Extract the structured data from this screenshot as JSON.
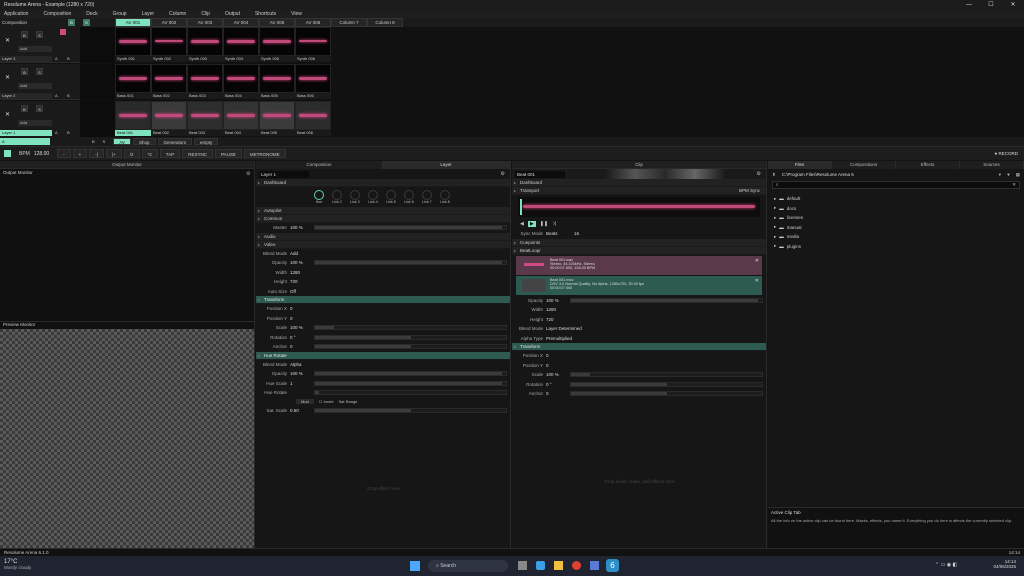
{
  "window": {
    "title": "Resolume Arena - Example (1280 x 720)",
    "controls": [
      "—",
      "☐",
      "✕"
    ]
  },
  "menu": [
    "Application",
    "Composition",
    "Deck",
    "Group",
    "Layer",
    "Column",
    "Clip",
    "Output",
    "Shortcuts",
    "View"
  ],
  "composition_label": "Composition",
  "columns": [
    "AV 001",
    "AV 002",
    "AV 003",
    "AV 004",
    "AV 005",
    "AV 006",
    "Column 7",
    "Column 8"
  ],
  "layers": [
    {
      "name": "Layer 3",
      "blend": "Add",
      "clips": [
        "Synth 001",
        "Synth 002",
        "Synth 003",
        "Synth 004",
        "Synth 005",
        "Synth 006"
      ]
    },
    {
      "name": "Layer 2",
      "blend": "Add",
      "clips": [
        "Bass 001",
        "Bass 002",
        "Bass 003",
        "Bass 004",
        "Bass 005",
        "Bass 006"
      ]
    },
    {
      "name": "Layer 1",
      "blend": "Add",
      "clips": [
        "Beat 001",
        "Beat 002",
        "Beat 003",
        "Beat 004",
        "Beat 005",
        "Beat 006"
      ]
    }
  ],
  "layer_buttons": {
    "x": "✕",
    "b": "B",
    "s": "S",
    "a": "A"
  },
  "decks": {
    "tabs": [
      "AV",
      "Shop",
      "Generators",
      "empty"
    ]
  },
  "transport_bar": {
    "bpm_label": "BPM",
    "bpm": "128.00",
    "buttons": [
      "-",
      "+",
      "-|",
      "|+",
      "/2",
      "*2",
      "TAP",
      "RESYNC",
      "PAUSE",
      "METRONOME"
    ],
    "record": "RECORD"
  },
  "output_monitor": {
    "title": "Output Monitor",
    "tab": "Output Monitor"
  },
  "preview_monitor": {
    "title": "Preview Monitor"
  },
  "center_tabs": [
    "Composition",
    "Layer"
  ],
  "layer_panel": {
    "layer_name": "Layer 1",
    "sections": {
      "dashboard": "Dashboard",
      "autopilot": "Autopilot",
      "common": "Common",
      "audio": "Audio",
      "video": "Video",
      "transform": "Transform",
      "hue_rotate": "Hue Rotate"
    },
    "knobs": [
      "Hue",
      "Link 2",
      "Link 3",
      "Link 4",
      "Link 5",
      "Link 6",
      "Link 7",
      "Link 8"
    ],
    "master": {
      "label": "Master",
      "value": "100 %"
    },
    "video": [
      {
        "label": "Blend Mode",
        "value": "Add"
      },
      {
        "label": "Opacity",
        "value": "100 %"
      },
      {
        "label": "Width",
        "value": "1280"
      },
      {
        "label": "Height",
        "value": "720"
      },
      {
        "label": "Auto Size",
        "value": "Off"
      }
    ],
    "transform": [
      {
        "label": "Position X",
        "value": "0"
      },
      {
        "label": "Position Y",
        "value": "0"
      },
      {
        "label": "Scale",
        "value": "100 %"
      },
      {
        "label": "Rotation",
        "value": "0 °"
      },
      {
        "label": "Anchor",
        "value": "0"
      }
    ],
    "hue": [
      {
        "label": "Blend Mode",
        "value": "Alpha"
      },
      {
        "label": "Opacity",
        "value": "100 %"
      },
      {
        "label": "Hue Scale",
        "value": "1"
      },
      {
        "label": "Hue Rotate",
        "value": ""
      },
      {
        "label": "Sat. Scale",
        "value": "0.50"
      }
    ],
    "hue_options": {
      "mode": "Mod",
      "invert": "Invert",
      "range": "Sat Range"
    },
    "drop_hint": "Drop effect here"
  },
  "clip_panel": {
    "title": "Clip",
    "clip_name": "Beat 001",
    "sections": {
      "dashboard": "Dashboard",
      "transport": "Transport",
      "cuepoints": "Cuepoints",
      "beatloopr": "BeatLoopr",
      "transform": "Transform"
    },
    "bpm_sync": "BPM Sync",
    "sync_mode": {
      "label": "Sync Mode",
      "value": "Beats",
      "beats": "16"
    },
    "audio_file": {
      "name": "Beat 001.wav",
      "info": "Stereo, 44.100kHz, Stereo",
      "dur": "00:00:07.500, 128.00 BPM"
    },
    "video_file": {
      "name": "Beat 001.mov",
      "info": "DXV 3.0 Normal Quality, No Alpha, 1280x720, 30.00 fps",
      "dur": "00:00:07.500"
    },
    "props": [
      {
        "label": "Opacity",
        "value": "100 %"
      },
      {
        "label": "Width",
        "value": "1280"
      },
      {
        "label": "Height",
        "value": "720"
      },
      {
        "label": "Blend Mode",
        "value": "Layer Determined"
      },
      {
        "label": "Alpha Type",
        "value": "Premultiplied"
      }
    ],
    "transform": [
      {
        "label": "Position X",
        "value": "0"
      },
      {
        "label": "Position Y",
        "value": "0"
      },
      {
        "label": "Scale",
        "value": "100 %"
      },
      {
        "label": "Rotation",
        "value": "0 °"
      },
      {
        "label": "Anchor",
        "value": "0"
      }
    ],
    "drop_hint": "Drop audio, video, and effects here"
  },
  "files_panel": {
    "tabs": [
      "Files",
      "Compositions",
      "Effects",
      "Sources"
    ],
    "path": "C:\\Program Files\\Resolume Arena 6",
    "folders": [
      "default",
      "docs",
      "licenses",
      "manual",
      "media",
      "plugins"
    ]
  },
  "help": {
    "title": "Active Clip Tab",
    "text": "All the info on the active clip can be found here. Masks, effects, you name it. Everything you do here is affects the currently selected clip."
  },
  "status": {
    "version": "Resolume Arena 6.1.0",
    "time": "14:14"
  },
  "taskbar": {
    "temp": "17°C",
    "weather": "Mostly cloudy",
    "search": "Search",
    "clock": "14:14",
    "date": "04/06/2025"
  },
  "colors": {
    "accent": "#7fe3bd",
    "pink": "#d04a84",
    "green_section": "#2e5b50"
  }
}
